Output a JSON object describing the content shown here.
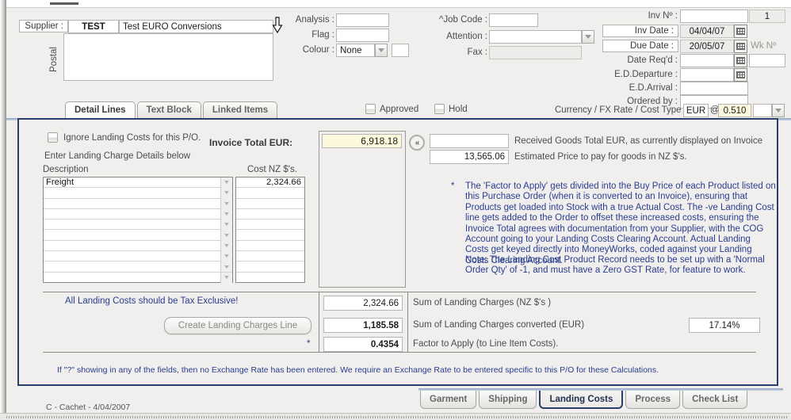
{
  "window": {
    "footer_note": "C - Cachet - 4/04/2007"
  },
  "header": {
    "supplier_label": "Supplier :",
    "supplier_code": "TEST",
    "supplier_name": "Test EURO Conversions",
    "postal_label": "Postal",
    "postal_value": "",
    "analysis_label": "Analysis :",
    "analysis_value": "",
    "flag_label": "Flag :",
    "flag_value": "",
    "colour_label": "Colour :",
    "colour_value": "None",
    "colour_extra_value": "",
    "jobcode_label": "^Job Code :",
    "jobcode_value": "",
    "attention_label": "Attention :",
    "attention_value": "",
    "fax_label": "Fax :",
    "fax_value": "",
    "invno_label": "Inv Nº :",
    "invno_value": "",
    "invno_seq": "1",
    "invdate_label": "Inv Date :",
    "invdate_value": "04/04/07",
    "duedate_label": "Due Date :",
    "duedate_value": "20/05/07",
    "wkno_label": "Wk Nº",
    "wkno_value": "",
    "datereqd_label": "Date Req'd :",
    "datereqd_value": "",
    "edeparture_label": "E.D.Departure :",
    "edeparture_value": "",
    "edarrival_label": "E.D.Arrival :",
    "edarrival_value": "",
    "orderedby_label": "Ordered by :",
    "orderedby_value": ""
  },
  "upper_tabs": [
    {
      "label": "Detail Lines",
      "selected": true
    },
    {
      "label": "Text Block",
      "selected": false
    },
    {
      "label": "Linked Items",
      "selected": false
    }
  ],
  "status_row": {
    "approved_label": "Approved",
    "hold_label": "Hold",
    "currency_label": "Currency / FX Rate / Cost Type :",
    "currency_code": "EUR",
    "at_symbol": "@",
    "fx_rate": "0.510",
    "cost_type": ""
  },
  "landing": {
    "ignore_label": "Ignore Landing Costs for this P/O.",
    "enter_details_label": "Enter Landing Charge Details below",
    "col_description": "Description",
    "col_cost": "Cost NZ $'s.",
    "rows": [
      {
        "description": "Freight",
        "cost": "2,324.66"
      },
      {
        "description": "",
        "cost": ""
      },
      {
        "description": "",
        "cost": ""
      },
      {
        "description": "",
        "cost": ""
      },
      {
        "description": "",
        "cost": ""
      },
      {
        "description": "",
        "cost": ""
      },
      {
        "description": "",
        "cost": ""
      },
      {
        "description": "",
        "cost": ""
      },
      {
        "description": "",
        "cost": ""
      },
      {
        "description": "",
        "cost": ""
      }
    ],
    "invoice_total_label": "Invoice Total EUR:",
    "invoice_total_value": "6,918.18",
    "collapse_icon": "«",
    "received_goods_value": "",
    "received_goods_label": "Received Goods Total EUR, as currently displayed on Invoice",
    "estimated_price_value": "13,565.06",
    "estimated_price_label": "Estimated Price to pay for goods in NZ $'s.",
    "info_bullet": "*",
    "info_paragraph": "The 'Factor to Apply' gets divided into the Buy Price of each Product listed on this Purchase Order (when it is converted to an Invoice), ensuring that Products get loaded into Stock with a true Actual Cost.  The -ve Landing Cost line gets added to the Order to offset these increased costs, ensuring the Invoice Total agrees with documentation from your Supplier, with the COG Account going to your Landing Costs Clearing Account.  Actual Landing Costs get keyed directly into MoneyWorks, coded against your Landing Costs Clearing Account.",
    "info_note": "Note:  The Landing Cost Product Record needs to be set up with a 'Normal Order Qty' of -1, and must have a Zero GST Rate, for feature to work.",
    "tax_exclusive_note": "All Landing Costs should be Tax Exclusive!",
    "create_line_button": "Create Landing Charges Line",
    "sum_nz_value": "2,324.66",
    "sum_nz_label": "Sum of Landing Charges (NZ $'s )",
    "sum_eur_value": "1,185.58",
    "sum_eur_label": "Sum of Landing Charges converted (EUR)",
    "factor_bullet": "*",
    "factor_value": "0.4354",
    "factor_label": "Factor to Apply (to Line Item Costs).",
    "percent_value": "17.14%",
    "exchange_warning": "If \"?\" showing in any of the fields, then no Exchange Rate has been entered.  We require an Exchange Rate to be entered specific to this P/O for these Calculations."
  },
  "bottom_tabs": [
    {
      "label": "Garment",
      "selected": false
    },
    {
      "label": "Shipping",
      "selected": false
    },
    {
      "label": "Landing Costs",
      "selected": true
    },
    {
      "label": "Process",
      "selected": false
    },
    {
      "label": "Check List",
      "selected": false
    }
  ],
  "colors": {
    "panel_border": "#2b3f6b",
    "blue_text": "#2a3d8f",
    "highlight_field": "#fcf8dc",
    "window_bg": "#f0efee"
  }
}
